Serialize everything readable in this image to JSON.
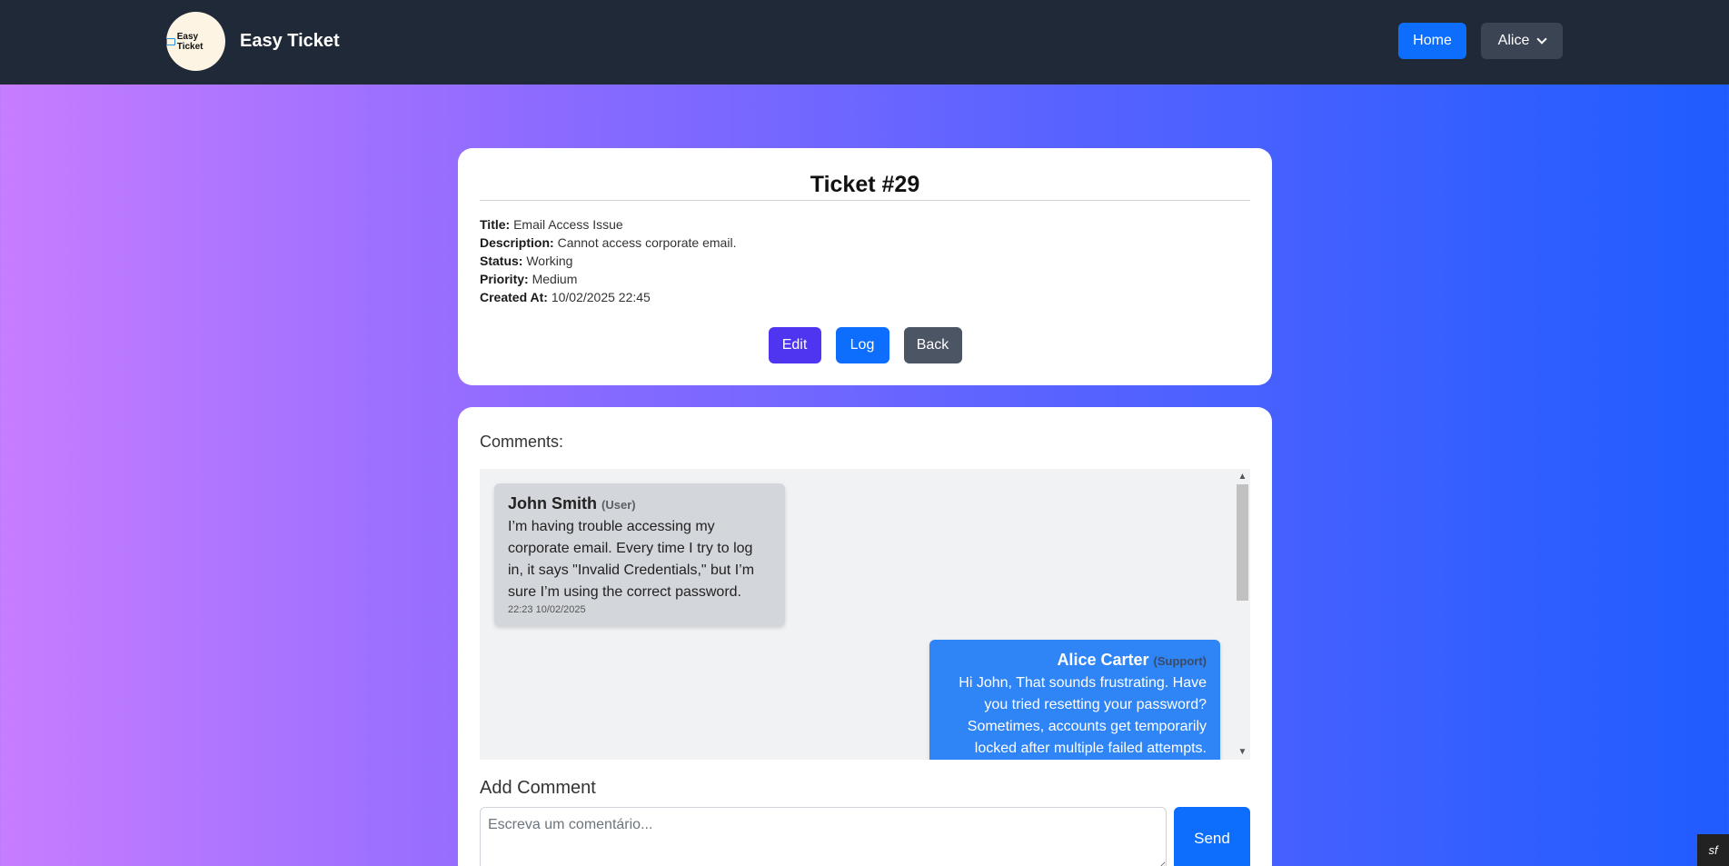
{
  "navbar": {
    "logo_text": "Easy Ticket",
    "brand": "Easy Ticket",
    "home_label": "Home",
    "user_label": "Alice"
  },
  "ticket": {
    "heading": "Ticket #29",
    "fields": [
      {
        "label": "Title:",
        "value": "Email Access Issue"
      },
      {
        "label": "Description:",
        "value": "Cannot access corporate email."
      },
      {
        "label": "Status:",
        "value": "Working"
      },
      {
        "label": "Priority:",
        "value": "Medium"
      },
      {
        "label": "Created At:",
        "value": "10/02/2025 22:45"
      }
    ],
    "buttons": {
      "edit": "Edit",
      "log": "Log",
      "back": "Back"
    }
  },
  "comments": {
    "label": "Comments:",
    "messages": [
      {
        "author": "John Smith",
        "role": "(User)",
        "text": "I’m having trouble accessing my corporate email. Every time I try to log in, it says \"Invalid Credentials,\" but I’m sure I’m using the correct password.",
        "time": "22:23 10/02/2025"
      },
      {
        "author": "Alice Carter",
        "role": "(Support)",
        "text": "Hi John, That sounds frustrating. Have you tried resetting your password? Sometimes, accounts get temporarily locked after multiple failed attempts."
      }
    ]
  },
  "add_comment": {
    "label": "Add Comment",
    "placeholder": "Escreva um comentário...",
    "send_label": "Send"
  },
  "debug_toolbar": {
    "glyph": "sf"
  }
}
